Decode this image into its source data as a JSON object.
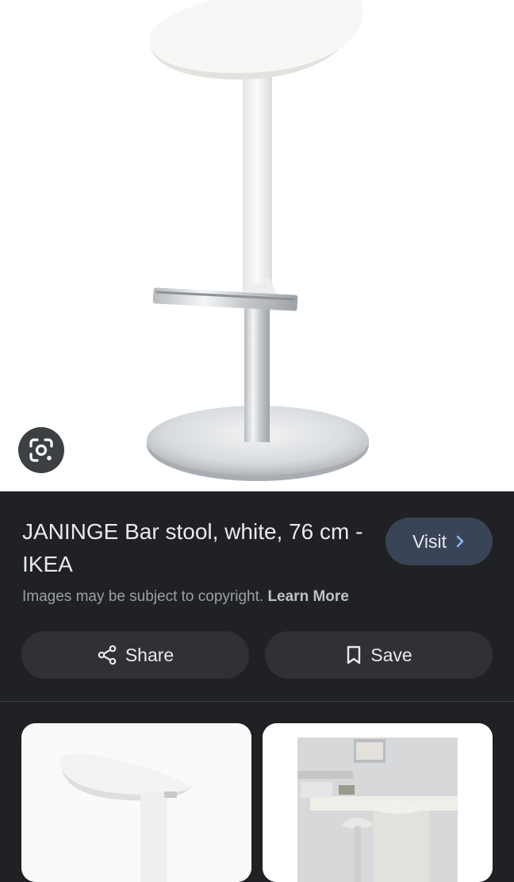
{
  "result": {
    "title": "JANINGE Bar stool, white, 76 cm - IKEA",
    "visit_label": "Visit",
    "copyright_text": "Images may be subject to copyright.",
    "learn_more_label": "Learn More"
  },
  "actions": {
    "share_label": "Share",
    "save_label": "Save"
  },
  "icons": {
    "lens": "google-lens-icon",
    "visit": "chevron-right-icon",
    "share": "share-icon",
    "save": "bookmark-icon"
  },
  "colors": {
    "panel_bg": "#202124",
    "visit_bg": "#394457",
    "button_bg": "#303134",
    "text": "#e8eaed",
    "muted": "#9aa0a6"
  }
}
